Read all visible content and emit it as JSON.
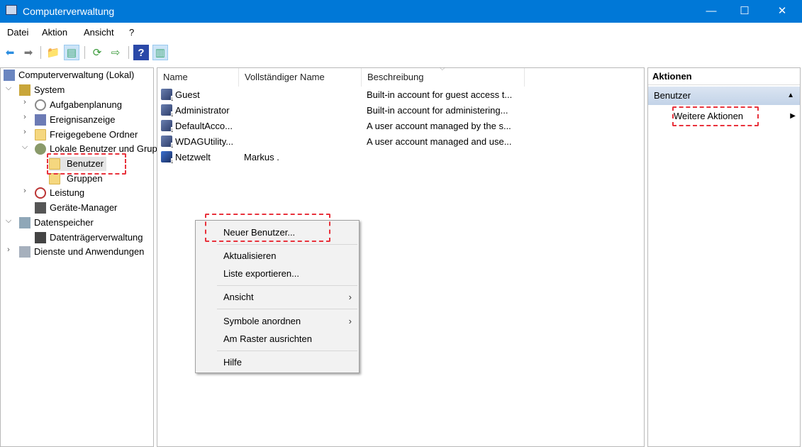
{
  "window": {
    "title": "Computerverwaltung",
    "controls": [
      "—",
      "☐",
      "✕"
    ]
  },
  "menu": [
    "Datei",
    "Aktion",
    "Ansicht",
    "?"
  ],
  "tree": {
    "root": "Computerverwaltung (Lokal)",
    "system": "System",
    "aufgaben": "Aufgabenplanung",
    "ereignis": "Ereignisanzeige",
    "freigabe": "Freigegebene Ordner",
    "lokale": "Lokale Benutzer und Gruppen",
    "benutzer": "Benutzer",
    "gruppen": "Gruppen",
    "leistung": "Leistung",
    "geraete": "Geräte-Manager",
    "datenspeicher": "Datenspeicher",
    "datentraeger": "Datenträgerverwaltung",
    "dienste": "Dienste und Anwendungen"
  },
  "list": {
    "columns": [
      "Name",
      "Vollständiger Name",
      "Beschreibung"
    ],
    "rows": [
      {
        "name": "Guest",
        "full": "",
        "desc": "Built-in account for guest access t..."
      },
      {
        "name": "Administrator",
        "full": "",
        "desc": "Built-in account for administering..."
      },
      {
        "name": "DefaultAcco...",
        "full": "",
        "desc": "A user account managed by the s..."
      },
      {
        "name": "WDAGUtility...",
        "full": "",
        "desc": "A user account managed and use..."
      },
      {
        "name": "Netzwelt",
        "full": "Markus .",
        "desc": ""
      }
    ]
  },
  "context_menu": [
    "Neuer Benutzer...",
    "Aktualisieren",
    "Liste exportieren...",
    "Ansicht",
    "Symbole anordnen",
    "Am Raster ausrichten",
    "Hilfe"
  ],
  "actions": {
    "title": "Aktionen",
    "section": "Benutzer",
    "item": "Weitere Aktionen"
  },
  "colors": {
    "titlebar": "#0078d7",
    "highlight": "#e8323c"
  }
}
